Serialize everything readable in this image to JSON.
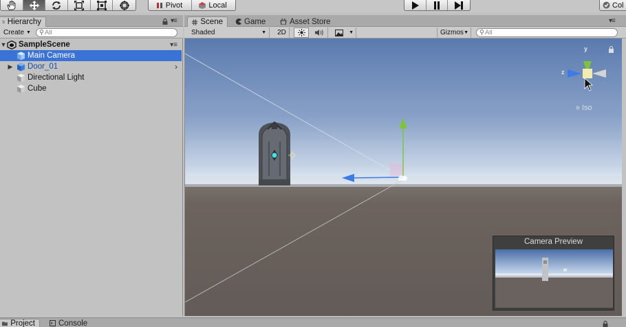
{
  "toolbar": {
    "tools": [
      "hand-icon",
      "move-icon",
      "rotate-icon",
      "scale-icon",
      "rect-icon",
      "transform-icon"
    ],
    "active_tool": "move-icon",
    "pivot_label": "Pivot",
    "local_label": "Local",
    "collab_label": "Col"
  },
  "hierarchy": {
    "tab_label": "Hierarchy",
    "create_label": "Create",
    "search_placeholder": "All",
    "scene_name": "SampleScene",
    "items": [
      {
        "label": "Main Camera",
        "selected": true,
        "has_children": false
      },
      {
        "label": "Door_01",
        "selected": false,
        "has_children": true
      },
      {
        "label": "Directional Light",
        "selected": false,
        "has_children": false
      },
      {
        "label": "Cube",
        "selected": false,
        "has_children": false
      }
    ]
  },
  "scene": {
    "tabs": [
      {
        "label": "Scene",
        "icon": "grid-icon",
        "active": true
      },
      {
        "label": "Game",
        "icon": "pacman-icon",
        "active": false
      },
      {
        "label": "Asset Store",
        "icon": "store-icon",
        "active": false
      }
    ],
    "shading_mode": "Shaded",
    "mode_2d_label": "2D",
    "gizmos_label": "Gizmos",
    "search_placeholder": "All",
    "iso_label": "Iso",
    "axis_labels": {
      "y": "y",
      "z": "z"
    }
  },
  "camera_preview": {
    "title": "Camera Preview"
  },
  "bottom": {
    "tabs": [
      {
        "label": "Project",
        "icon": "folder-icon",
        "active": true
      },
      {
        "label": "Console",
        "icon": "console-icon",
        "active": false
      }
    ]
  },
  "colors": {
    "selection": "#3a72d6",
    "sky_top": "#5e7eb0",
    "horizon": "#ccd8e8",
    "ground": "#6b625e",
    "gizmo_y": "#7ec33a",
    "gizmo_z": "#3d7be8",
    "gizmo_x": "#d0d0d0"
  }
}
